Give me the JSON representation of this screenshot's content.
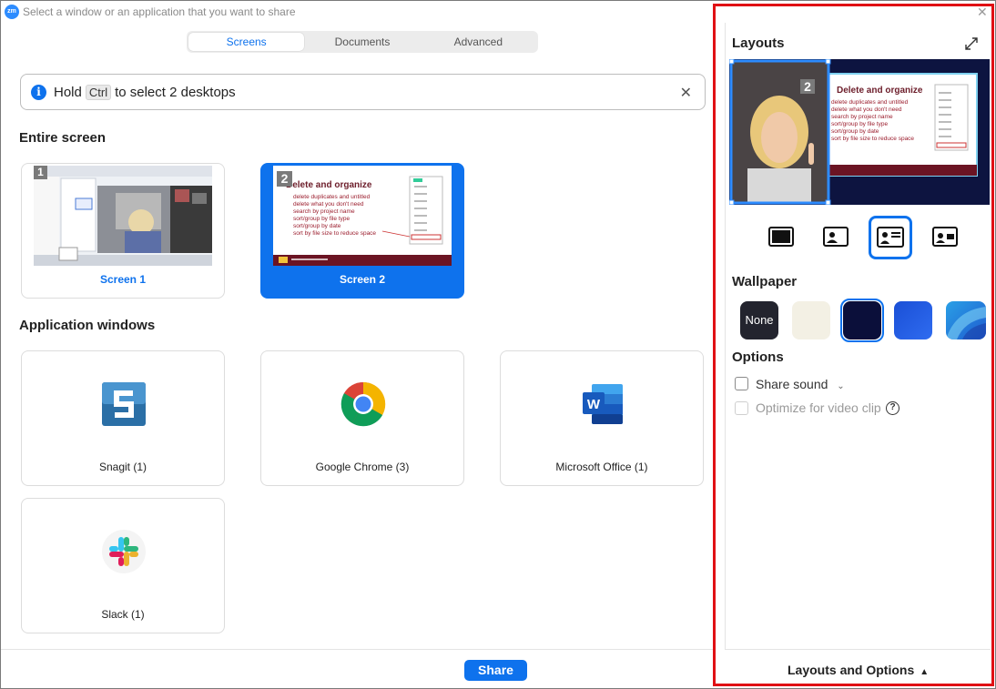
{
  "titlebar": {
    "logo": "zm",
    "title": "Select a window or an application that you want to share"
  },
  "tabs": [
    {
      "label": "Screens",
      "active": true
    },
    {
      "label": "Documents",
      "active": false
    },
    {
      "label": "Advanced",
      "active": false
    }
  ],
  "infobar": {
    "pre": "Hold",
    "key": "Ctrl",
    "post": "to select 2 desktops",
    "icon": "info-icon",
    "close": "✕"
  },
  "entire_screen": {
    "title": "Entire screen",
    "screens": [
      {
        "label": "Screen 1",
        "number": "1",
        "selected": false
      },
      {
        "label": "Screen 2",
        "number": "2",
        "selected": true
      }
    ]
  },
  "slide": {
    "heading": "Delete and organize",
    "bullets": [
      "delete duplicates and untitled",
      "delete what you don't need",
      "search by project name",
      "sort/group by file type",
      "sort/group by date",
      "sort by file size to reduce space"
    ]
  },
  "application_windows": {
    "title": "Application windows",
    "apps": [
      {
        "label": "Snagit (1)",
        "icon": "snagit-icon"
      },
      {
        "label": "Google Chrome (3)",
        "icon": "chrome-icon"
      },
      {
        "label": "Microsoft Office (1)",
        "icon": "word-icon"
      },
      {
        "label": "Slack (1)",
        "icon": "slack-icon"
      }
    ]
  },
  "share_button": "Share",
  "panel": {
    "layouts_title": "Layouts",
    "preview_badge": "2",
    "layout_options": [
      "screen-only-icon",
      "presenter-bottom-right-icon",
      "presenter-left-icon",
      "presenter-side-icon"
    ],
    "wallpaper_title": "Wallpaper",
    "wallpapers": [
      {
        "label": "None",
        "color": "#23242e"
      },
      {
        "label": "",
        "color": "#f3f0e4"
      },
      {
        "label": "",
        "color": "#0b0f3a",
        "selected": true
      },
      {
        "label": "",
        "color": "#1f5fe0"
      },
      {
        "label": "",
        "color": "#2a7fd6"
      }
    ],
    "options_title": "Options",
    "share_sound": "Share sound",
    "optimize": "Optimize for video clip",
    "footer": "Layouts and Options"
  },
  "colors": {
    "accent": "#0e72ed",
    "highlight_border": "#e01014"
  }
}
